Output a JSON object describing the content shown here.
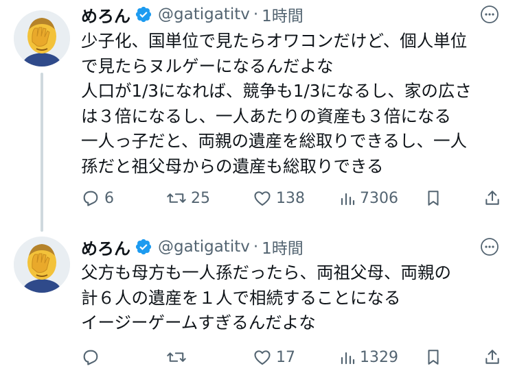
{
  "tweets": [
    {
      "name": "めろん",
      "handle": "@gatigatitv",
      "separator": "·",
      "time": "1時間",
      "lines": [
        "少子化、国単位で見たらオワコンだけど、個人単位",
        "で見たらヌルゲーになるんだよな",
        "人口が1/3になれば、競争も1/3になるし、家の広さ",
        "は３倍になるし、一人あたりの資産も３倍になる",
        "一人っ子だと、両親の遺産を総取りできるし、一人",
        "孫だと祖父母からの遺産も総取りできる"
      ],
      "replies": "6",
      "retweets": "25",
      "likes": "138",
      "views": "7306"
    },
    {
      "name": "めろん",
      "handle": "@gatigatitv",
      "separator": "·",
      "time": "1時間",
      "lines": [
        "父方も母方も一人孫だったら、両祖父母、両親の",
        "計６人の遺産を１人で相続することになる",
        "イージーゲームすぎるんだよな"
      ],
      "replies": "",
      "retweets": "",
      "likes": "17",
      "views": "1329"
    }
  ],
  "icons": {
    "verified": "verified-badge-icon",
    "more": "more-icon",
    "reply": "reply-icon",
    "retweet": "retweet-icon",
    "like": "heart-icon",
    "views": "views-icon",
    "bookmark": "bookmark-icon",
    "share": "share-icon"
  },
  "colors": {
    "verified": "#1d9bf0",
    "muted": "#536471",
    "text": "#0f1419",
    "thread_line": "#cfd9de"
  }
}
